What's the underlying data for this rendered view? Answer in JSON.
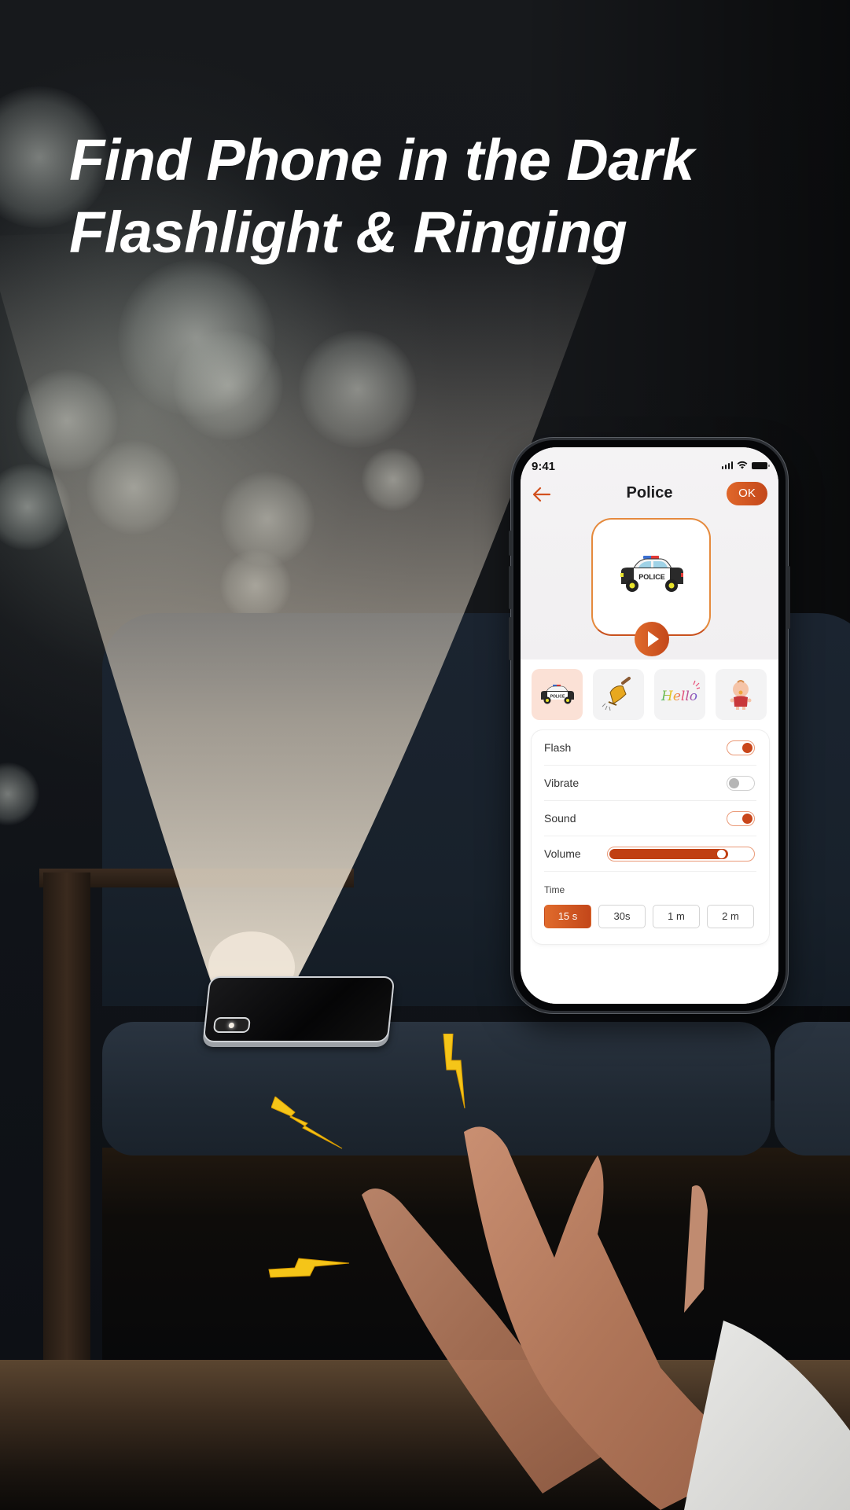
{
  "headline": {
    "line1": "Find Phone in the Dark",
    "line2": "Flashlight & Ringing"
  },
  "phone": {
    "status_bar": {
      "time": "9:41",
      "icons": [
        "cellular-signal-icon",
        "wifi-icon",
        "battery-icon"
      ]
    },
    "nav": {
      "back_icon": "arrow-left-icon",
      "title": "Police",
      "ok_label": "OK"
    },
    "preview": {
      "icon": "police-car-icon",
      "play_icon": "play-icon"
    },
    "sounds": [
      {
        "name": "police",
        "icon": "police-car-icon",
        "selected": true
      },
      {
        "name": "bell",
        "icon": "bell-icon",
        "selected": false
      },
      {
        "name": "hello",
        "icon": "hello-text-icon",
        "selected": false
      },
      {
        "name": "baby",
        "icon": "baby-icon",
        "selected": false
      }
    ],
    "settings": {
      "flash": {
        "label": "Flash",
        "on": true
      },
      "vibrate": {
        "label": "Vibrate",
        "on": false
      },
      "sound": {
        "label": "Sound",
        "on": true
      },
      "volume": {
        "label": "Volume",
        "value_percent": 83
      }
    },
    "time": {
      "label": "Time",
      "options": [
        "15 s",
        "30s",
        "1 m",
        "2 m"
      ],
      "selected": "15 s"
    }
  },
  "colors": {
    "accent": "#c9461a",
    "accent_light": "#e06b2c",
    "selected_tile": "#fbe1d6",
    "bolt": "#f5c518"
  }
}
